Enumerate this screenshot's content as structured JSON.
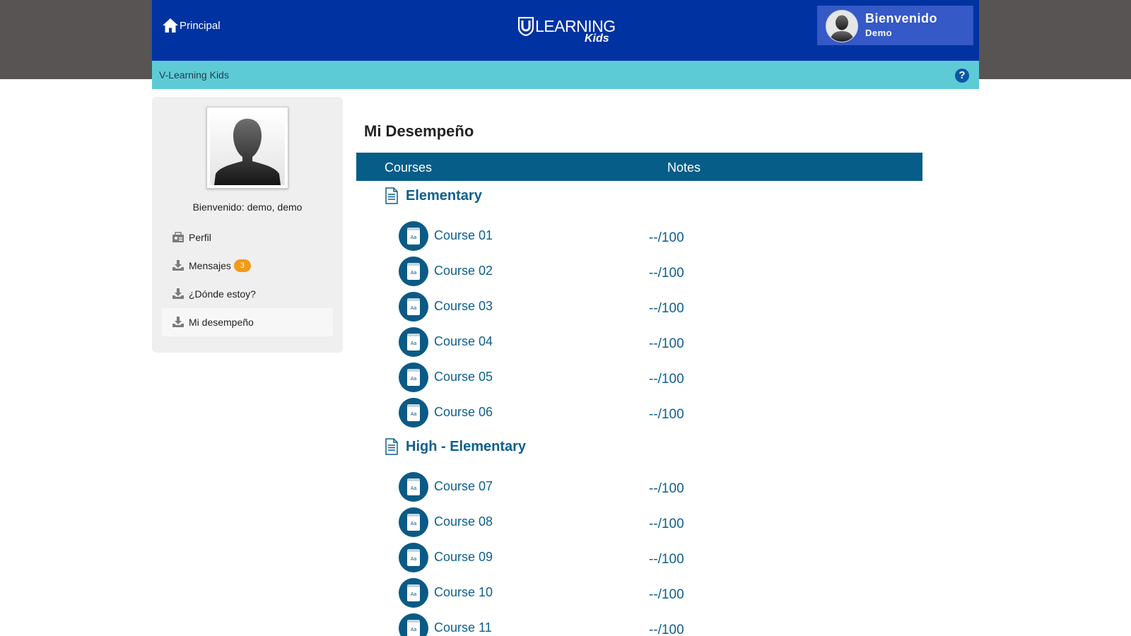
{
  "header": {
    "home_label": "Principal",
    "logo_text": "LEARNING",
    "logo_subtext": "Kids",
    "user_greeting": "Bienvenido",
    "user_name": "Demo"
  },
  "subbar": {
    "title": "V-Learning Kids",
    "help_label": "?"
  },
  "sidebar": {
    "welcome": "Bienvenido: demo, demo",
    "menu": [
      {
        "label": "Perfil"
      },
      {
        "label": "Mensajes",
        "badge": "3"
      },
      {
        "label": "¿Dónde estoy?"
      },
      {
        "label": "Mi desempeño"
      }
    ]
  },
  "main": {
    "title": "Mi Desempeño",
    "columns": {
      "courses": "Courses",
      "notes": "Notes"
    },
    "sections": [
      {
        "title": "Elementary",
        "courses": [
          {
            "name": "Course 01",
            "note": "--/100"
          },
          {
            "name": "Course 02",
            "note": "--/100"
          },
          {
            "name": "Course 03",
            "note": "--/100"
          },
          {
            "name": "Course 04",
            "note": "--/100"
          },
          {
            "name": "Course 05",
            "note": "--/100"
          },
          {
            "name": "Course 06",
            "note": "--/100"
          }
        ]
      },
      {
        "title": "High - Elementary",
        "courses": [
          {
            "name": "Course 07",
            "note": "--/100"
          },
          {
            "name": "Course 08",
            "note": "--/100"
          },
          {
            "name": "Course 09",
            "note": "--/100"
          },
          {
            "name": "Course 10",
            "note": "--/100"
          },
          {
            "name": "Course 11",
            "note": "--/100"
          }
        ]
      }
    ]
  },
  "colors": {
    "header": "#0033a1",
    "subbar": "#5dcbd5",
    "table_header": "#055d88",
    "accent_text": "#0d5f8e",
    "badge": "#f39a17"
  }
}
